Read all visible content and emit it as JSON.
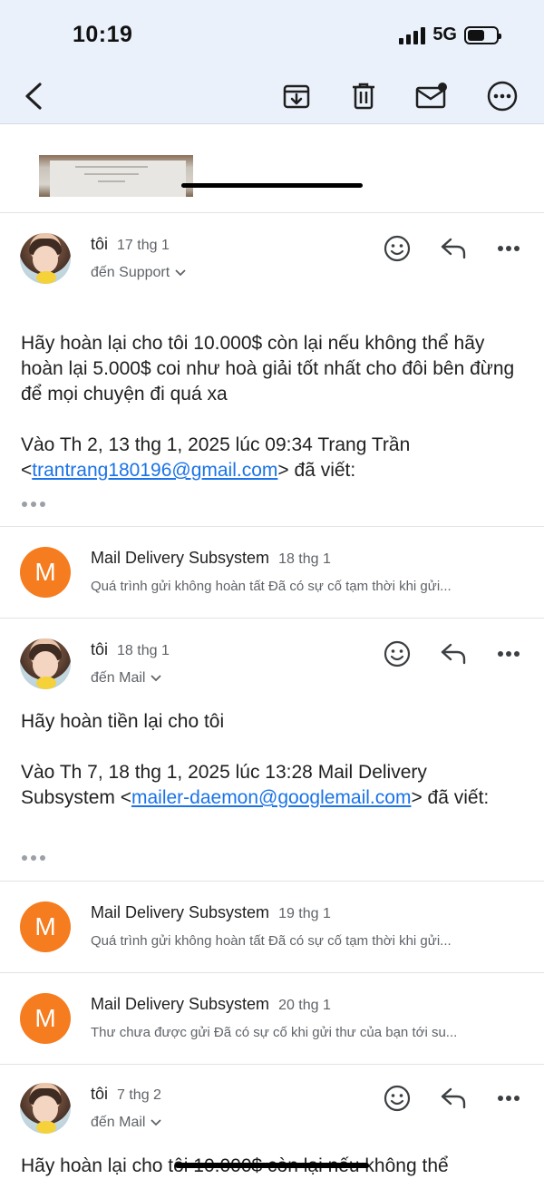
{
  "status": {
    "time": "10:19",
    "network": "5G",
    "battery_level": 0.6
  },
  "toolbar": {
    "back": "back-arrow-icon",
    "archive": "archive-icon",
    "delete": "trash-icon",
    "mark_unread": "mail-unread-icon",
    "more": "more-circle-icon"
  },
  "messages": [
    {
      "sender": "tôi",
      "date": "17 thg 1",
      "to": "đến Support",
      "body_p1": "Hãy hoàn lại cho tôi 10.000$ còn lại nếu không thể hãy hoàn lại 5.000$ coi như hoà giải tốt nhất cho đôi bên đừng để mọi chuyện đi quá xa",
      "quote_prefix": "Vào Th 2, 13 thg 1, 2025 lúc 09:34 Trang Trần <",
      "quote_email": "trantrang180196@gmail.com",
      "quote_suffix": "> đã viết:"
    },
    {
      "sender": "Mail Delivery Subsystem",
      "avatar_letter": "M",
      "date": "18 thg 1",
      "preview": "Quá trình gửi không hoàn tất Đã có sự cố tạm thời khi gửi..."
    },
    {
      "sender": "tôi",
      "date": "18 thg 1",
      "to": "đến Mail",
      "body_p1": "Hãy hoàn tiền lại cho tôi",
      "quote_prefix": "Vào Th 7, 18 thg 1, 2025 lúc 13:28 Mail Delivery Subsystem <",
      "quote_email": "mailer-daemon@googlemail.com",
      "quote_suffix": "> đã viết:"
    },
    {
      "sender": "Mail Delivery Subsystem",
      "avatar_letter": "M",
      "date": "19 thg 1",
      "preview": "Quá trình gửi không hoàn tất Đã có sự cố tạm thời khi gửi..."
    },
    {
      "sender": "Mail Delivery Subsystem",
      "avatar_letter": "M",
      "date": "20 thg 1",
      "preview": "Thư chưa được gửi Đã có sự cố khi gửi thư của bạn tới su..."
    },
    {
      "sender": "tôi",
      "date": "7 thg 2",
      "to": "đến Mail",
      "body_p1": "Hãy hoàn lại cho tôi 10.000$ còn lại nếu không thể"
    }
  ],
  "colors": {
    "header_bg": "#eaf1fb",
    "avatar_orange": "#f57c1f",
    "link": "#1a73e8"
  }
}
